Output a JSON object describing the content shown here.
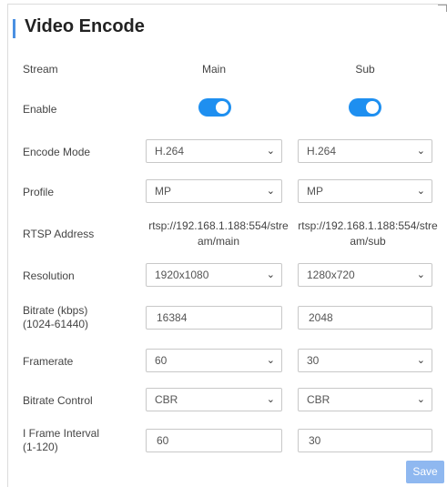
{
  "page": {
    "title": "Video Encode"
  },
  "columns": {
    "stream_label": "Stream",
    "main": "Main",
    "sub": "Sub"
  },
  "rows": {
    "enable": {
      "label": "Enable",
      "main_on": true,
      "sub_on": true
    },
    "encode_mode": {
      "label": "Encode Mode",
      "main": "H.264",
      "sub": "H.264"
    },
    "profile": {
      "label": "Profile",
      "main": "MP",
      "sub": "MP"
    },
    "rtsp": {
      "label": "RTSP Address",
      "main_line1": "rtsp://192.168.1.188:554/stre",
      "main_line2": "am/main",
      "sub_line1": "rtsp://192.168.1.188:554/stre",
      "sub_line2": "am/sub"
    },
    "resolution": {
      "label": "Resolution",
      "main": "1920x1080",
      "sub": "1280x720"
    },
    "bitrate": {
      "label_line1": "Bitrate (kbps)",
      "label_line2": "(1024-61440)",
      "main": "16384",
      "sub": "2048"
    },
    "framerate": {
      "label": "Framerate",
      "main": "60",
      "sub": "30"
    },
    "bitrate_control": {
      "label": "Bitrate Control",
      "main": "CBR",
      "sub": "CBR"
    },
    "iframe": {
      "label_line1": "I Frame Interval",
      "label_line2": "(1-120)",
      "main": "60",
      "sub": "30"
    }
  },
  "actions": {
    "save": "Save"
  },
  "colors": {
    "accent": "#4a90e2",
    "toggle_on": "#1e8ff0",
    "save_disabled": "#8fb8f0"
  },
  "icons": {
    "dropdown": "chevron-down-icon"
  }
}
